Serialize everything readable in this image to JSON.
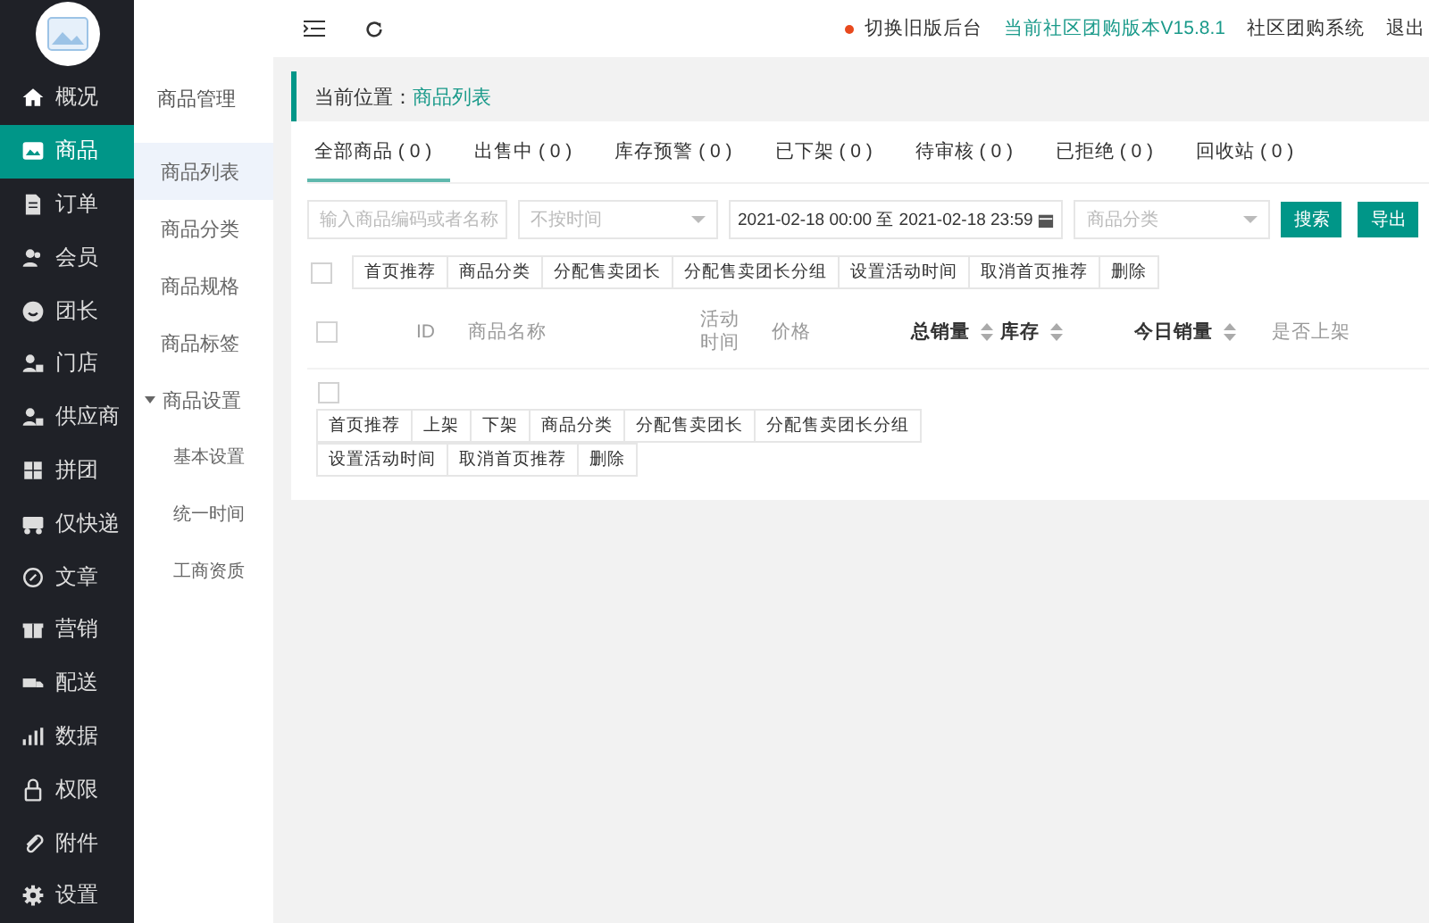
{
  "sidebar": {
    "items": [
      {
        "label": "概况",
        "selected": false
      },
      {
        "label": "商品",
        "selected": true
      },
      {
        "label": "订单",
        "selected": false
      },
      {
        "label": "会员",
        "selected": false
      },
      {
        "label": "团长",
        "selected": false
      },
      {
        "label": "门店",
        "selected": false
      },
      {
        "label": "供应商",
        "selected": false
      },
      {
        "label": "拼团",
        "selected": false
      },
      {
        "label": "仅快递",
        "selected": false
      },
      {
        "label": "文章",
        "selected": false
      },
      {
        "label": "营销",
        "selected": false
      },
      {
        "label": "配送",
        "selected": false
      },
      {
        "label": "数据",
        "selected": false
      },
      {
        "label": "权限",
        "selected": false
      },
      {
        "label": "附件",
        "selected": false
      },
      {
        "label": "设置",
        "selected": false
      }
    ]
  },
  "submenu": {
    "title": "商品管理",
    "items": [
      {
        "label": "商品列表",
        "selected": true
      },
      {
        "label": "商品分类",
        "selected": false
      },
      {
        "label": "商品规格",
        "selected": false
      },
      {
        "label": "商品标签",
        "selected": false
      },
      {
        "label": "商品设置",
        "selected": false,
        "expanded": true,
        "children": [
          {
            "label": "基本设置",
            "selected": false
          },
          {
            "label": "统一时间",
            "selected": false
          },
          {
            "label": "工商资质",
            "selected": false
          }
        ]
      }
    ]
  },
  "topbar": {
    "links": [
      {
        "label": "切换旧版后台",
        "kind": "alert"
      },
      {
        "label": "当前社区团购版本V15.8.1",
        "kind": "highlight"
      },
      {
        "label": "社区团购系统",
        "kind": "plain"
      },
      {
        "label": "退出",
        "kind": "plain"
      }
    ]
  },
  "breadcrumb": {
    "label": "当前位置：",
    "current": "商品列表"
  },
  "tabs": [
    {
      "label": "全部商品 ( 0 )",
      "selected": true
    },
    {
      "label": "出售中 ( 0 )",
      "selected": false
    },
    {
      "label": "库存预警 ( 0 )",
      "selected": false
    },
    {
      "label": "已下架 ( 0 )",
      "selected": false
    },
    {
      "label": "待审核 ( 0 )",
      "selected": false
    },
    {
      "label": "已拒绝 ( 0 )",
      "selected": false
    },
    {
      "label": "回收站 ( 0 )",
      "selected": false
    }
  ],
  "filters": {
    "search": {
      "placeholder": "输入商品编码或者名称"
    },
    "time": {
      "placeholder": "不按时间"
    },
    "date_range": {
      "value": "2021-02-18 00:00 至 2021-02-18 23:59"
    },
    "category": {
      "placeholder": "商品分类"
    },
    "buttons": [
      "搜索",
      "导出"
    ]
  },
  "batch_actions": {
    "checked": false,
    "buttons": [
      "首页推荐",
      "商品分类",
      "分配售卖团长",
      "分配售卖团长分组",
      "设置活动时间",
      "取消首页推荐",
      "删除"
    ]
  },
  "table": {
    "checked": false,
    "columns": [
      {
        "label": "ID",
        "sortable": false
      },
      {
        "label": "商品名称",
        "sortable": false
      },
      {
        "label": "活动时间",
        "sortable": false
      },
      {
        "label": "价格",
        "sortable": false
      },
      {
        "label": "总销量",
        "sortable": true
      },
      {
        "label": "库存",
        "sortable": true
      },
      {
        "label": "今日销量",
        "sortable": true
      },
      {
        "label": "是否上架",
        "sortable": false
      }
    ]
  },
  "footer_actions": {
    "checked": false,
    "buttons": [
      "首页推荐",
      "上架",
      "下架",
      "商品分类",
      "分配售卖团长",
      "分配售卖团长分组",
      "设置活动时间",
      "取消首页推荐",
      "删除"
    ]
  }
}
